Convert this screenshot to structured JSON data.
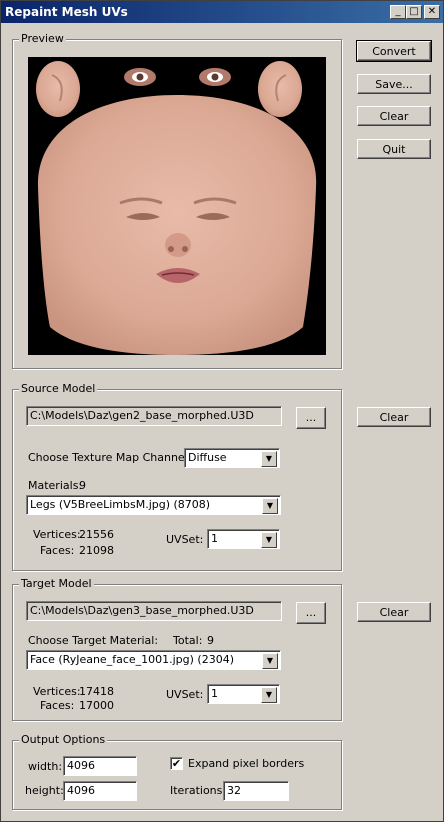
{
  "window": {
    "title": "Repaint Mesh UVs",
    "minimize": "_",
    "maximize": "□",
    "close": "✕"
  },
  "preview": {
    "title": "Preview",
    "texture_colors": {
      "background": "#000000",
      "skin": "#e2b09c",
      "skin_shadow": "#c98f7a",
      "lips": "#b8656a"
    }
  },
  "buttons": {
    "convert": "Convert",
    "save": "Save...",
    "clear": "Clear",
    "quit": "Quit",
    "clear_source": "Clear",
    "clear_target": "Clear"
  },
  "source_model": {
    "title": "Source Model",
    "path": "C:\\Models\\Daz\\gen2_base_morphed.U3D",
    "browse": "...",
    "channel_label": "Choose Texture Map Channel:",
    "channel_value": "Diffuse",
    "materials_label": "Materials:",
    "materials_count": "9",
    "material_value": "Legs (V5BreeLimbsM.jpg) (8708)",
    "vertices_label": "Vertices:",
    "vertices": "21556",
    "faces_label": "Faces:",
    "faces": "21098",
    "uvset_label": "UVSet:",
    "uvset_value": "1"
  },
  "target_model": {
    "title": "Target Model",
    "path": "C:\\Models\\Daz\\gen3_base_morphed.U3D",
    "browse": "...",
    "material_label": "Choose Target Material:",
    "total_label": "Total:",
    "total": "9",
    "material_value": "Face (RyJeane_face_1001.jpg) (2304)",
    "vertices_label": "Vertices:",
    "vertices": "17418",
    "faces_label": "Faces:",
    "faces": "17000",
    "uvset_label": "UVSet:",
    "uvset_value": "1"
  },
  "output_options": {
    "title": "Output Options",
    "width_label": "width:",
    "width": "4096",
    "height_label": "height:",
    "height": "4096",
    "expand_label": "Expand pixel borders",
    "expand_checked": "✔",
    "iterations_label": "Iterations:",
    "iterations": "32"
  }
}
